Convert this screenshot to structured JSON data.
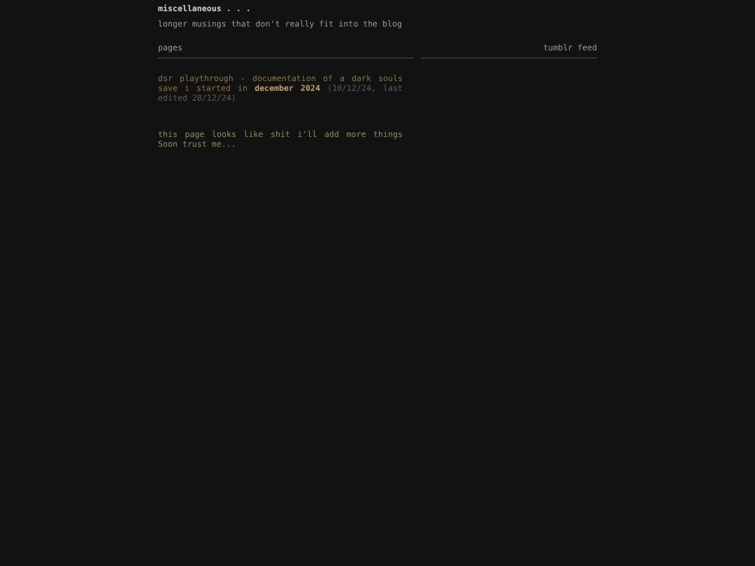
{
  "header": {
    "title": "miscellaneous . . .",
    "subtitle": "longer musings that don't really fit into the blog"
  },
  "nav": [
    {
      "label": "pages"
    },
    {
      "label": "tumblr feed"
    }
  ],
  "entries": [
    {
      "title": "dsr playthrough - documentation of a dark souls save i started in **december 2024**",
      "date": "(10/12/24, last edited 28/12/24)"
    }
  ],
  "note": "this page looks like shit i'll add more things Soon trust me..."
}
